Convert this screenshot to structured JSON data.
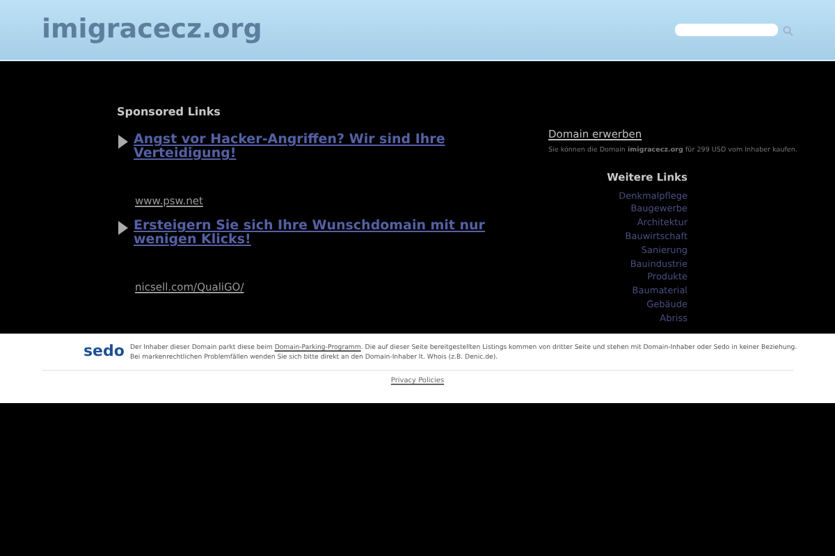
{
  "header": {
    "site_title": "imigracecz.org"
  },
  "sponsored": {
    "title": "Sponsored Links",
    "ads": [
      {
        "headline": "Angst vor Hacker-Angriffen? Wir sind Ihre Verteidigung!",
        "url": "www.psw.net"
      },
      {
        "headline": "Ersteigern Sie sich Ihre Wunschdomain mit nur wenigen Klicks!",
        "url": "nicsell.com/QualiGO/"
      }
    ]
  },
  "domain_offer": {
    "title": "Domain erwerben",
    "text": "Sie können die Domain **imigracecz.org** für 299 USD vom Inhaber kaufen."
  },
  "more_links": {
    "title": "Weitere Links",
    "items": [
      "Denkmalpflege",
      "Baugewerbe",
      "Architektur",
      "Bauwirtschaft",
      "Sanierung",
      "Bauindustrie",
      "Produkte",
      "Baumaterial",
      "Gebäude",
      "Abriss"
    ]
  },
  "footer": {
    "logo": "sedo",
    "text_before": "Der Inhaber dieser Domain parkt diese beim",
    "link": "Domain-Parking-Programm",
    "text_after": ". Die auf dieser Seite bereitgestellten Listings kommen von dritter Seite und stehen mit Domain-Inhaber oder Sedo in keiner Beziehung.",
    "line2": "Bei markenrechtlichen Problemfällen wenden Sie sich bitte direkt an den Domain-Inhaber lt. Whois (z.B. Denic.de).",
    "privacy": "Privacy Policies"
  }
}
